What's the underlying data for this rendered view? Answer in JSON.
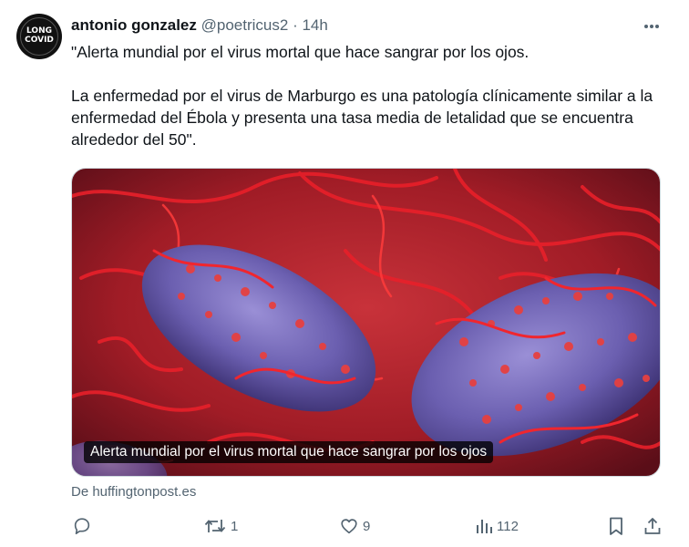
{
  "tweet": {
    "avatar_alt": "LONG COVID",
    "avatar_line1": "LONG",
    "avatar_line2": "COVID",
    "author_name": "antonio gonzalez",
    "handle": "@poetricus2",
    "separator": "·",
    "time": "14h",
    "text_para1": "\"Alerta mundial por el virus mortal que hace sangrar por los ojos.",
    "text_para2": "La enfermedad por el virus de Marburgo es una patología clínicamente similar a la enfermedad del Ébola y presenta una tasa media de letalidad que se encuentra alrededor del 50\".",
    "card_caption": "Alerta mundial por el virus mortal que hace sangrar por los ojos",
    "card_source": "De huffingtonpost.es"
  },
  "actions": {
    "replies": "",
    "retweets": "1",
    "likes": "9",
    "views": "112"
  },
  "icons": {
    "more": "more-horizontal-icon",
    "reply": "reply-icon",
    "retweet": "retweet-icon",
    "like": "heart-icon",
    "views": "views-chart-icon",
    "bookmark": "bookmark-icon",
    "share": "share-icon"
  },
  "colors": {
    "text": "#0f1419",
    "secondary": "#536471",
    "image_red": "#e01b24",
    "image_purple": "#6b5fb0"
  }
}
